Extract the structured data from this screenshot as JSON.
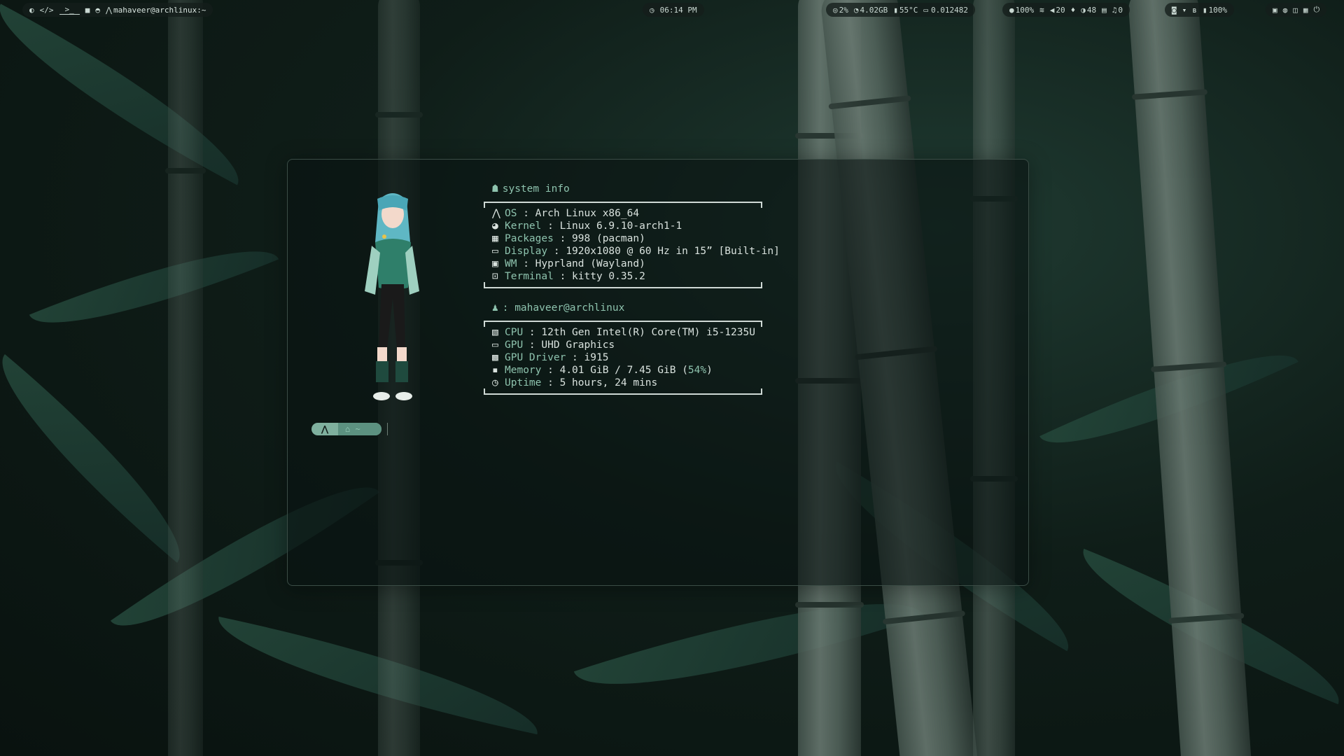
{
  "topbar": {
    "left_icons": [
      "os-icon",
      "code-icon",
      "terminal-icon",
      "folder-icon",
      "discord-icon"
    ],
    "window_title": "mahaveer@archlinux:~",
    "clock": "06:14 PM",
    "stats": {
      "cpu": "2%",
      "memory": "4.02GB",
      "temp": "55°C",
      "misc": "0.012482"
    },
    "status": {
      "wifi_strength": "100%",
      "volume": "20",
      "brightness": "48",
      "notifications": "0"
    },
    "tray": {
      "battery": "100%"
    }
  },
  "fetch": {
    "system_heading": "system info",
    "system_rows": [
      {
        "icon": "arch-icon",
        "key": "OS",
        "value": "Arch Linux x86_64"
      },
      {
        "icon": "kernel-icon",
        "key": "Kernel",
        "value": "Linux 6.9.10-arch1-1"
      },
      {
        "icon": "package-icon",
        "key": "Packages",
        "value": "998 (pacman)"
      },
      {
        "icon": "monitor-icon",
        "key": "Display",
        "value": "1920x1080 @ 60 Hz in 15” [Built-in]"
      },
      {
        "icon": "window-icon",
        "key": "WM",
        "value": "Hyprland (Wayland)"
      },
      {
        "icon": "terminal-icon",
        "key": "Terminal",
        "value": "kitty 0.35.2"
      }
    ],
    "user_heading": ": mahaveer@archlinux",
    "hardware_rows": [
      {
        "icon": "cpu-icon",
        "key": "CPU",
        "value": "12th Gen Intel(R) Core(TM) i5-1235U"
      },
      {
        "icon": "monitor-icon",
        "key": "GPU",
        "value": "UHD Graphics"
      },
      {
        "icon": "chip-icon",
        "key": "GPU Driver",
        "value": "i915"
      },
      {
        "icon": "memory-icon",
        "key": "Memory",
        "value": "4.01 GiB / 7.45 GiB (",
        "pct": "54%",
        "tail": ")"
      },
      {
        "icon": "clock-icon",
        "key": "Uptime ",
        "value": "5 hours, 24 mins"
      }
    ]
  },
  "prompt": {
    "os_glyph": "⋀",
    "dir_glyph": "⌂ ~"
  }
}
